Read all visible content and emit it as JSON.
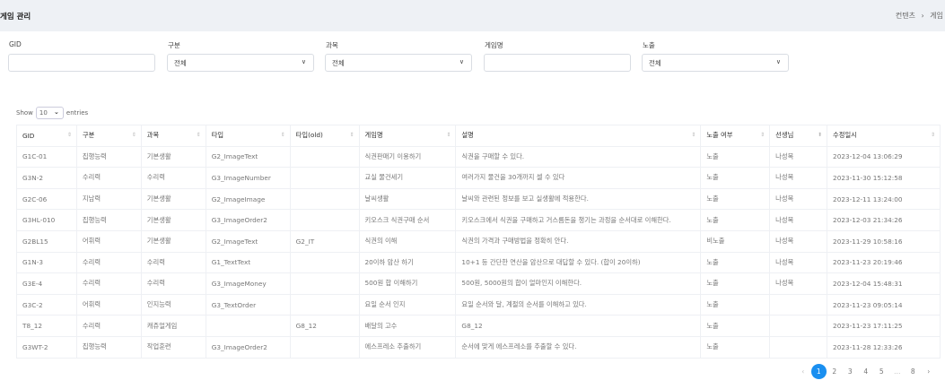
{
  "header": {
    "title": "게임 관리",
    "breadcrumb": [
      "컨텐츠",
      "게임"
    ],
    "breadcrumb_sep": "›"
  },
  "filters": [
    {
      "label": "GID",
      "value": "",
      "type": "input"
    },
    {
      "label": "구분",
      "value": "전체",
      "type": "select"
    },
    {
      "label": "과목",
      "value": "전체",
      "type": "select"
    },
    {
      "label": "게임명",
      "value": "",
      "type": "input"
    },
    {
      "label": "노출",
      "value": "전체",
      "type": "select"
    }
  ],
  "length": {
    "show": "Show",
    "value": "10",
    "entries": "entries"
  },
  "table": {
    "columns": [
      "GID",
      "구분",
      "과목",
      "타입",
      "타입(old)",
      "게임명",
      "설명",
      "노출 여부",
      "선생님",
      "수정일시"
    ],
    "rows": [
      [
        "G1C-01",
        "집행능력",
        "기본생활",
        "G2_ImageText",
        "",
        "식권판매기 이용하기",
        "식권을 구매할 수 있다.",
        "노출",
        "나성목",
        "2023-12-04 13:06:29"
      ],
      [
        "G3N-2",
        "수리력",
        "수리력",
        "G3_ImageNumber",
        "",
        "교실 물건세기",
        "여러가지 물건을 30개까지 셀 수 있다",
        "노출",
        "나성목",
        "2023-11-30 15:12:58"
      ],
      [
        "G2C-06",
        "지남력",
        "기본생활",
        "G2_ImageImage",
        "",
        "날씨생활",
        "날씨와 관련된 정보를 보고 실생활에 적용한다.",
        "노출",
        "나성목",
        "2023-12-11 13:24:00"
      ],
      [
        "G3HL-010",
        "집행능력",
        "기본생활",
        "G3_ImageOrder2",
        "",
        "키오스크 식권구매 순서",
        "키오스크에서 식권을 구매하고 거스름돈을 챙기는 과정을 순서대로 이해한다.",
        "노출",
        "나성목",
        "2023-12-03 21:34:26"
      ],
      [
        "G2BL15",
        "어휘력",
        "기본생활",
        "G2_ImageText",
        "G2_IT",
        "식권의 이해",
        "식권의 가격과 구매방법을 정확히 안다.",
        "비노출",
        "나성목",
        "2023-11-29 10:58:16"
      ],
      [
        "G1N-3",
        "수리력",
        "수리력",
        "G1_TextText",
        "",
        "20이하 암산 하기",
        "10+1 등 간단한 연산을 암산으로 대답할 수 있다. (합이 20이하)",
        "노출",
        "나성목",
        "2023-11-23 20:19:46"
      ],
      [
        "G3E-4",
        "수리력",
        "수리력",
        "G3_ImageMoney",
        "",
        "500원 합 이해하기",
        "500원, 5000원의 합이 얼마인지 이해한다.",
        "노출",
        "나성목",
        "2023-12-04 15:48:31"
      ],
      [
        "G3C-2",
        "어휘력",
        "인지능력",
        "G3_TextOrder",
        "",
        "요일 순서 인지",
        "요일 순서와 달, 계절의 순서를 이해하고 있다.",
        "노출",
        "",
        "2023-11-23 09:05:14"
      ],
      [
        "T8_12",
        "수리력",
        "캐쥬얼게임",
        "",
        "G8_12",
        "배달의 고수",
        "G8_12",
        "노출",
        "",
        "2023-11-23 17:11:25"
      ],
      [
        "G3WT-2",
        "집행능력",
        "작업훈련",
        "G3_ImageOrder2",
        "",
        "에스프레소 추출하기",
        "순서에 맞게 에스프레소를 추출할 수 있다.",
        "노출",
        "",
        "2023-11-28 12:33:26"
      ]
    ]
  },
  "pagination": {
    "prev": "‹",
    "pages": [
      "1",
      "2",
      "3",
      "4",
      "5",
      "…",
      "8"
    ],
    "active": "1",
    "next": "›"
  },
  "colors": {
    "accent": "#1a8ff0",
    "header_bg": "#eef1f5"
  }
}
